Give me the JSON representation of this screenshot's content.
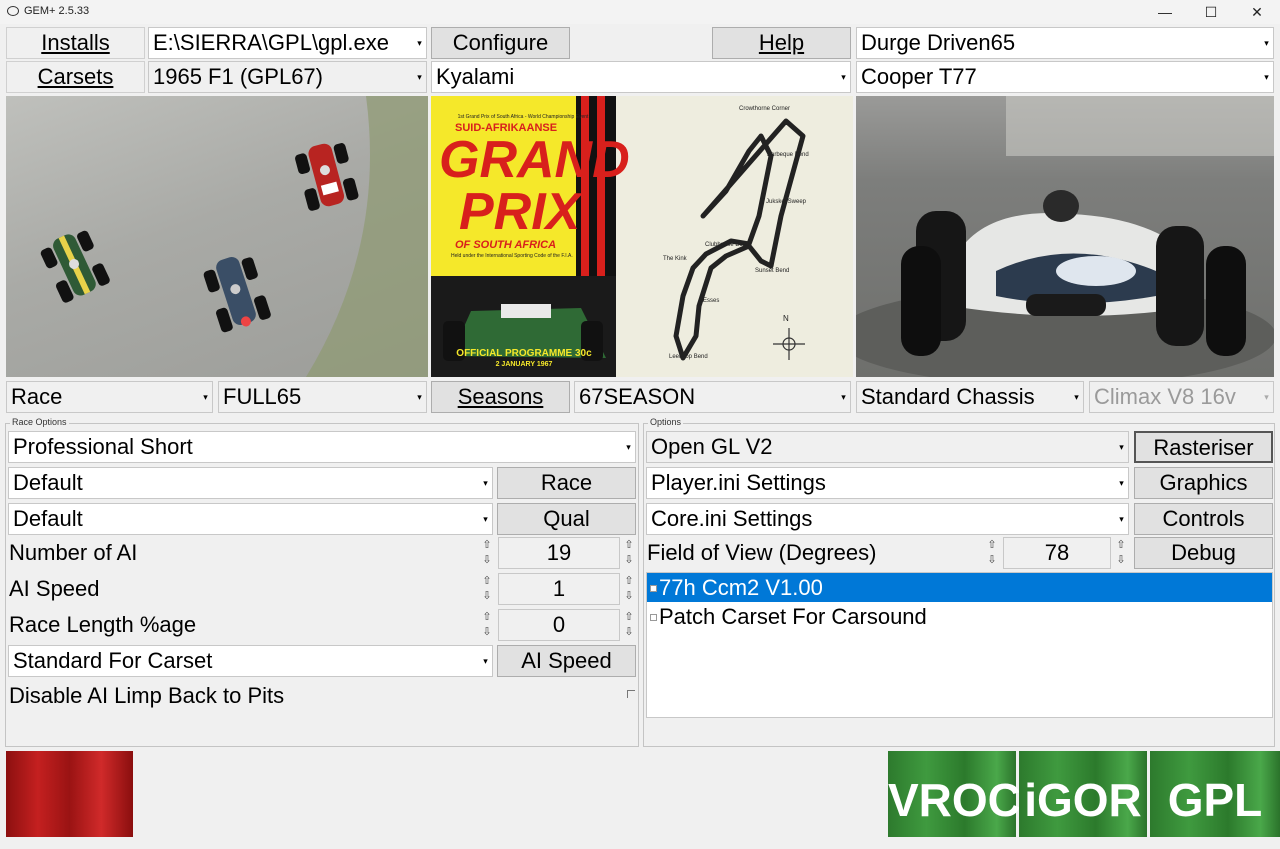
{
  "window": {
    "title": "GEM+ 2.5.33",
    "min": "—",
    "max": "☐",
    "close": "✕"
  },
  "row1": {
    "installs_label": "Installs",
    "install_path": "E:\\SIERRA\\GPL\\gpl.exe",
    "configure_label": "Configure",
    "help_label": "Help",
    "driver": "Durge Driven65"
  },
  "row2": {
    "carsets_label": "Carsets",
    "carset": "1965 F1 (GPL67)",
    "track": "Kyalami",
    "car": "Cooper T77"
  },
  "poster": {
    "top_line": "1st Grand Prix of South Africa - World Championship Event",
    "suid": "SUID-AFRIKAANSE",
    "grand": "GRAND",
    "prix": "PRIX",
    "of": "OF SOUTH AFRICA",
    "sub": "Held under the International Sporting Code of the F.I.A.",
    "programme": "OFFICIAL PROGRAMME 30c",
    "date": "2 JANUARY 1967",
    "corners": [
      "Crowthorne Corner",
      "Barbeque Bend",
      "Jukskei Sweep",
      "Clubhouse Bend",
      "The Kink",
      "Sunset Bend",
      "Esses",
      "Leeukop Bend"
    ],
    "north": "N"
  },
  "row3": {
    "mode": "Race",
    "track_variant": "FULL65",
    "seasons_label": "Seasons",
    "season": "67SEASON",
    "chassis": "Standard Chassis",
    "engine": "Climax V8 16v"
  },
  "race_options": {
    "title": "Race Options",
    "difficulty": "Professional Short",
    "race_setting": "Default",
    "race_button": "Race",
    "qual_setting": "Default",
    "qual_button": "Qual",
    "num_ai_label": "Number of AI",
    "num_ai": "19",
    "ai_speed_label": "AI Speed",
    "ai_speed": "1",
    "race_length_label": "Race Length %age",
    "race_length": "0",
    "ai_speed_setting": "Standard For Carset",
    "ai_speed_button": "AI Speed",
    "limp_label": "Disable AI Limp Back to Pits"
  },
  "options": {
    "title": "Options",
    "renderer": "Open GL V2",
    "rasteriser_button": "Rasteriser",
    "player_ini": "Player.ini Settings",
    "graphics_button": "Graphics",
    "core_ini": "Core.ini Settings",
    "controls_button": "Controls",
    "fov_label": "Field of View (Degrees)",
    "fov": "78",
    "debug_button": "Debug",
    "mods": [
      {
        "label": "77h Ccm2 V1.00",
        "selected": true
      },
      {
        "label": "Patch Carset For Carsound",
        "selected": false
      }
    ]
  },
  "launchers": {
    "vroc": "VROC",
    "igor": "iGOR",
    "gpl": "GPL"
  },
  "colors": {
    "selection": "#0078d7",
    "launcher_green": "#3f9a3f",
    "poster_yellow": "#f5e82a",
    "poster_red": "#d8201c"
  }
}
